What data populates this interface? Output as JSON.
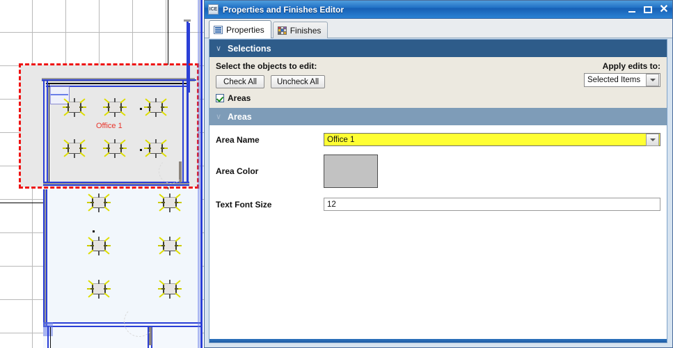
{
  "window": {
    "title": "Properties and Finishes Editor",
    "app_icon": "ICE",
    "icon_name": "ice-app-icon",
    "minimize_label": "–",
    "maximize_label": "□",
    "close_label": "✕"
  },
  "tabs": [
    {
      "label": "Properties",
      "icon": "list-icon",
      "active": true
    },
    {
      "label": "Finishes",
      "icon": "color-grid-icon",
      "active": false
    }
  ],
  "selections": {
    "header": "Selections",
    "chevron": "∨",
    "prompt": "Select the objects to edit:",
    "check_all": "Check All",
    "uncheck_all": "Uncheck All",
    "apply_label": "Apply edits to:",
    "apply_value": "Selected Items",
    "checkbox_label": "Areas",
    "checkbox_checked": true
  },
  "areas": {
    "header": "Areas",
    "chevron": "∨",
    "fields": [
      {
        "label": "Area Name",
        "value": "Office 1",
        "type": "combobox",
        "highlight": "#ffff33"
      },
      {
        "label": "Area Color",
        "value": "",
        "type": "color-swatch",
        "color": "#c2c2c2"
      },
      {
        "label": "Text Font Size",
        "value": "12",
        "type": "text"
      }
    ],
    "area_name_label": "Area Name",
    "area_name_value": "Office 1",
    "area_color_label": "Area Color",
    "area_color_value": "#c2c2c2",
    "font_size_label": "Text Font Size",
    "font_size_value": "12"
  },
  "cad": {
    "area_label": "Office 1",
    "label_color": "#e8332a",
    "selection_color": "#ee1111",
    "wall_color": "#2b3fd6",
    "grid_color": "#b9b9b9",
    "area_fill_color": "#e8e8e8",
    "room_fill_color": "#f2f7fc"
  },
  "colors": {
    "titlebar": "#1f6fc4",
    "section_dark": "#2e5c8a",
    "section_light": "#7e9cb8",
    "selection_panel": "#ece9e0",
    "accent": "#2b3fd6"
  }
}
